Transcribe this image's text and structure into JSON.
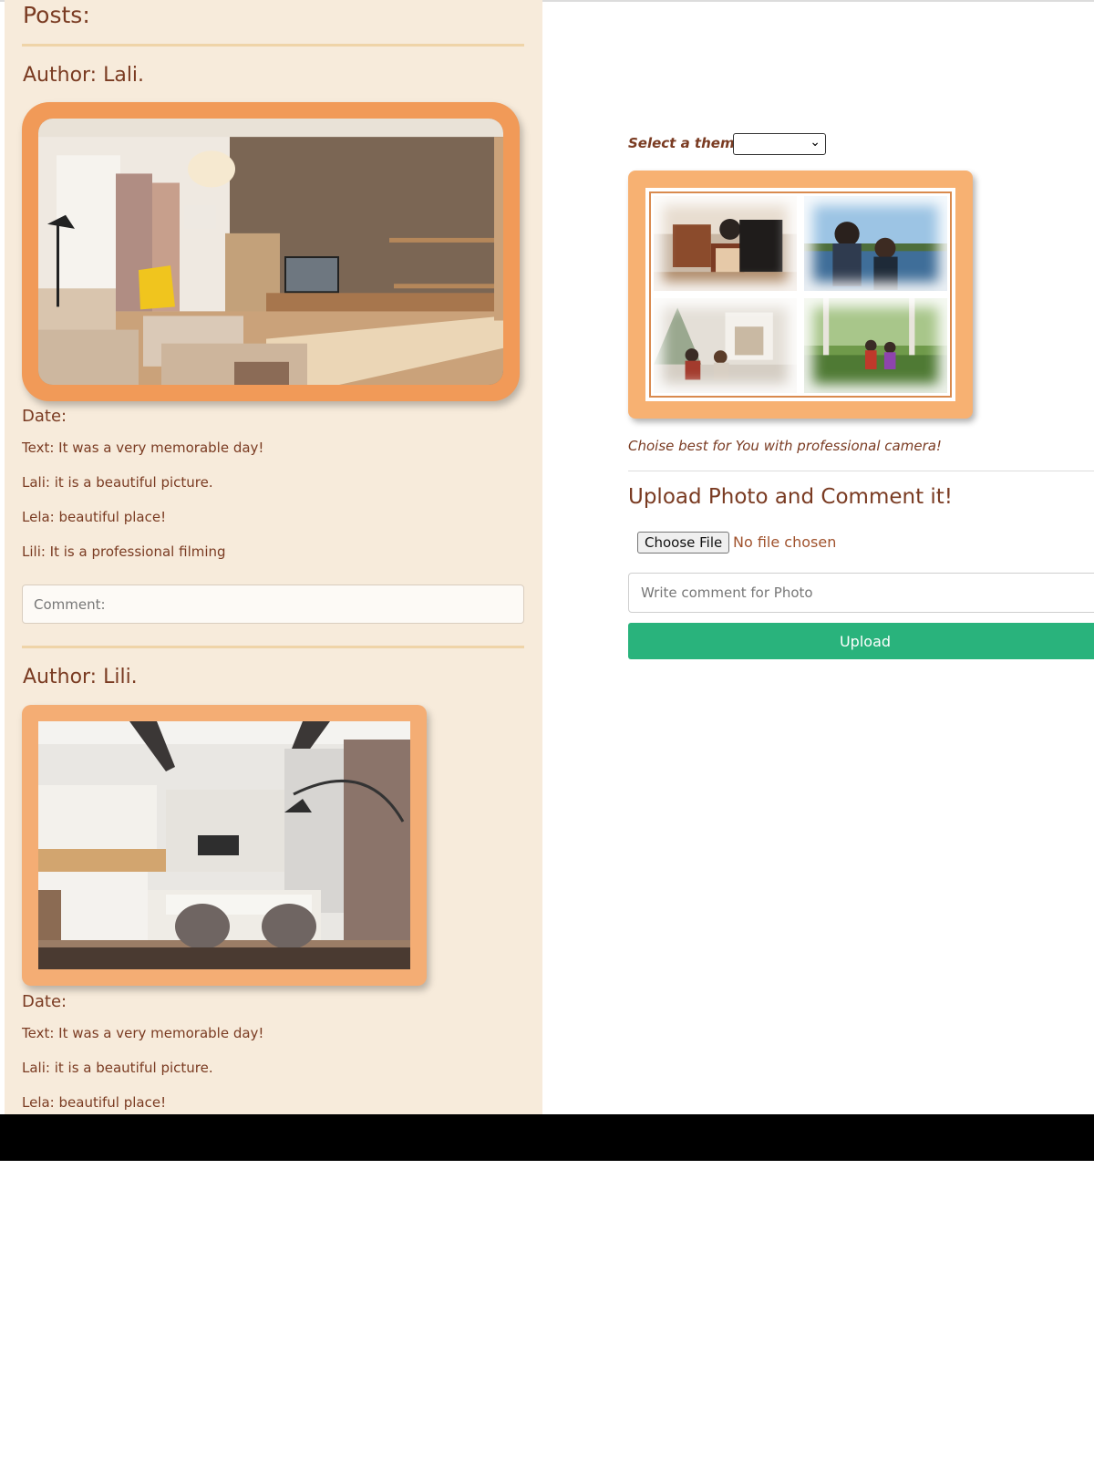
{
  "posts": {
    "title": "Posts:",
    "items": [
      {
        "author": "Author: Lali.",
        "date_label": "Date:",
        "text": "Text: It was a very memorable day!",
        "comments": [
          "Lali: it is a beautiful picture.",
          "Lela: beautiful place!",
          "Lili: It is a professional filming"
        ],
        "comment_placeholder": "Comment:"
      },
      {
        "author": "Author: Lili.",
        "date_label": "Date:",
        "text": "Text: It was a very memorable day!",
        "comments": [
          "Lali: it is a beautiful picture.",
          "Lela: beautiful place!"
        ]
      }
    ]
  },
  "theme": {
    "label": "Select a theme:",
    "selected": ""
  },
  "collage": {
    "caption": "Choise best for You with professional camera!"
  },
  "upload": {
    "title": "Upload Photo and Comment it!",
    "file_button": "Choose File",
    "file_status": "No file chosen",
    "comment_placeholder": "Write comment for Photo",
    "submit_label": "Upload"
  },
  "colors": {
    "text": "#7a3b22",
    "posts_bg": "#f7ebdb",
    "frame_orange": "#f19a58",
    "frame_light_orange": "#f4ad74",
    "upload_green": "#29b37c"
  }
}
